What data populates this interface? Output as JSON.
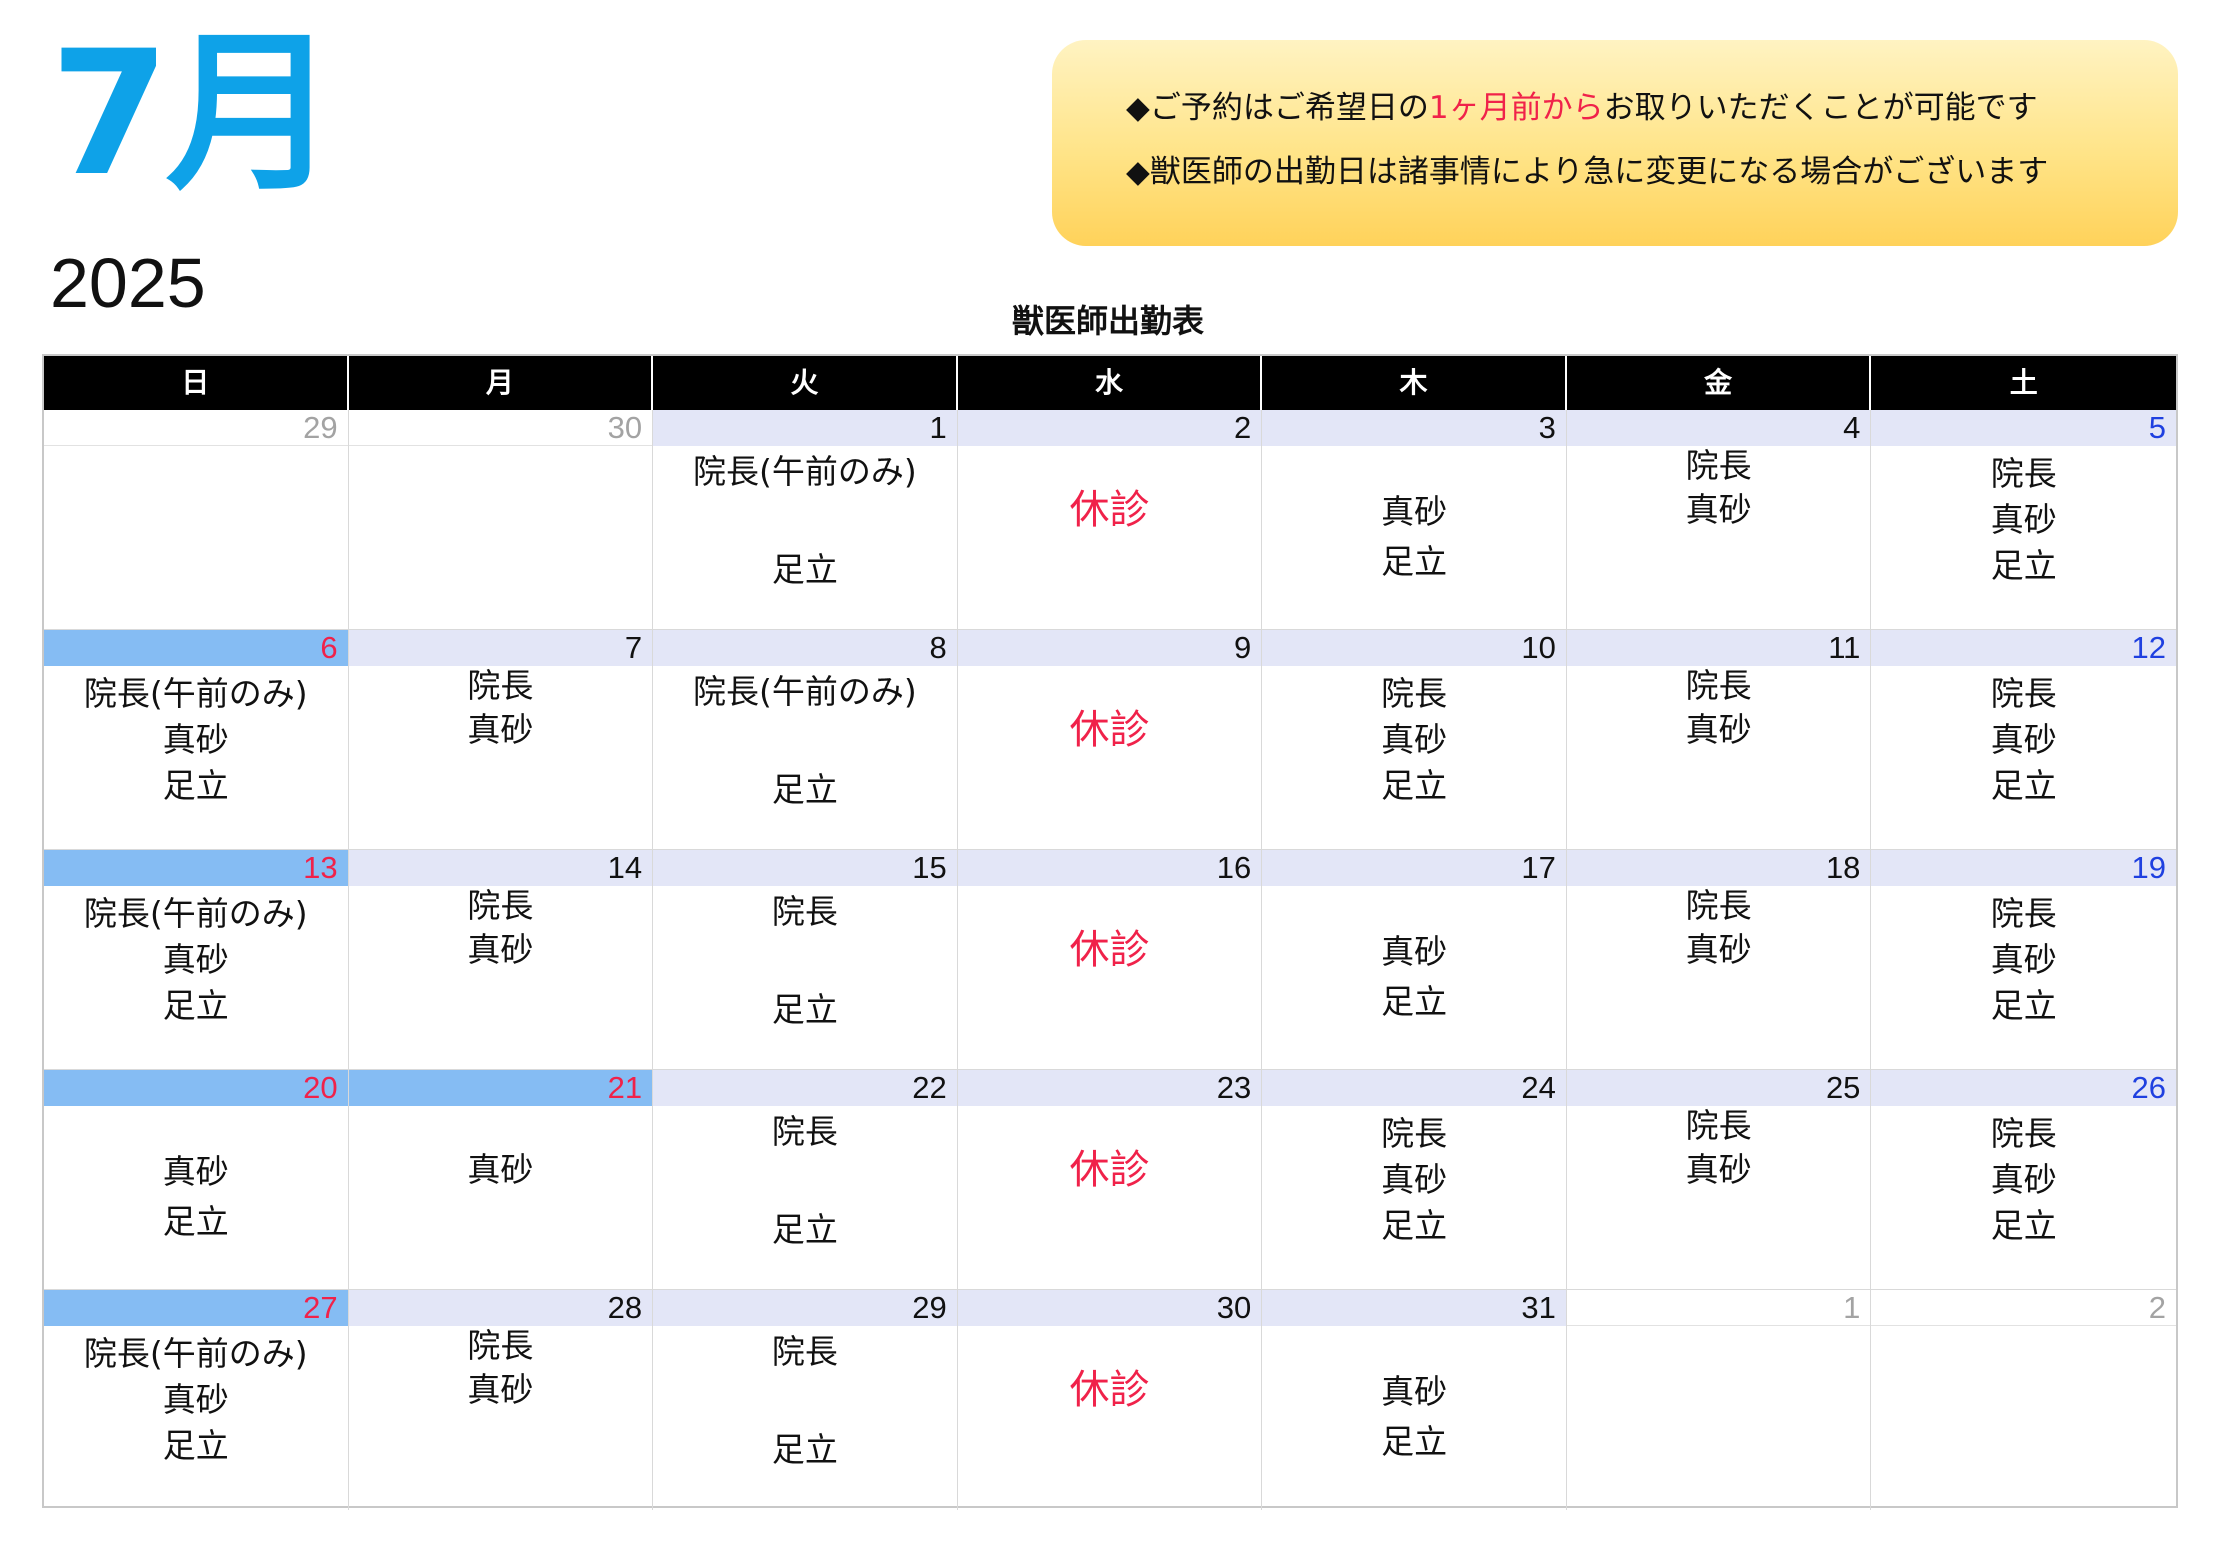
{
  "header": {
    "month": "7月",
    "year": "2025",
    "notice": [
      {
        "before": "◆ご予約はご希望日の",
        "highlight": "1ヶ月前から",
        "after": "お取りいただくことが可能です"
      },
      {
        "before": "◆獣医師の出勤日は諸事情により急に変更になる場合がございます",
        "highlight": "",
        "after": ""
      }
    ],
    "table_title": "獣医師出勤表"
  },
  "colors": {
    "month_blue": "#0ea2e8",
    "highlight_red": "#f0224a",
    "saturday_blue": "#1f40e0",
    "holiday_bg": "#85bcf3",
    "date_bg": "#e3e6f7"
  },
  "weekdays": [
    "日",
    "月",
    "火",
    "水",
    "木",
    "金",
    "土"
  ],
  "weeks": [
    [
      {
        "day": "29",
        "kind": "other",
        "lines": []
      },
      {
        "day": "30",
        "kind": "other",
        "lines": []
      },
      {
        "day": "1",
        "kind": "normal",
        "lines": [
          "院長(午前のみ)",
          "",
          "足立"
        ],
        "align": "spread"
      },
      {
        "day": "2",
        "kind": "normal",
        "lines": [
          "休診"
        ],
        "align": "closed"
      },
      {
        "day": "3",
        "kind": "normal",
        "lines": [
          "",
          "真砂",
          "足立"
        ],
        "align": "bottom2"
      },
      {
        "day": "4",
        "kind": "normal",
        "lines": [
          "院長",
          "真砂"
        ],
        "align": "top2"
      },
      {
        "day": "5",
        "kind": "sat",
        "lines": [
          "院長",
          "真砂",
          "足立"
        ],
        "align": "three"
      }
    ],
    [
      {
        "day": "6",
        "kind": "holiday",
        "lines": [
          "院長(午前のみ)",
          "真砂",
          "足立"
        ],
        "align": "three"
      },
      {
        "day": "7",
        "kind": "normal",
        "lines": [
          "院長",
          "真砂"
        ],
        "align": "top2"
      },
      {
        "day": "8",
        "kind": "normal",
        "lines": [
          "院長(午前のみ)",
          "",
          "足立"
        ],
        "align": "spread"
      },
      {
        "day": "9",
        "kind": "normal",
        "lines": [
          "休診"
        ],
        "align": "closed"
      },
      {
        "day": "10",
        "kind": "normal",
        "lines": [
          "院長",
          "真砂",
          "足立"
        ],
        "align": "three"
      },
      {
        "day": "11",
        "kind": "normal",
        "lines": [
          "院長",
          "真砂"
        ],
        "align": "top2"
      },
      {
        "day": "12",
        "kind": "sat",
        "lines": [
          "院長",
          "真砂",
          "足立"
        ],
        "align": "three"
      }
    ],
    [
      {
        "day": "13",
        "kind": "holiday",
        "lines": [
          "院長(午前のみ)",
          "真砂",
          "足立"
        ],
        "align": "three"
      },
      {
        "day": "14",
        "kind": "normal",
        "lines": [
          "院長",
          "真砂"
        ],
        "align": "top2"
      },
      {
        "day": "15",
        "kind": "normal",
        "lines": [
          "院長",
          "",
          "足立"
        ],
        "align": "spread"
      },
      {
        "day": "16",
        "kind": "normal",
        "lines": [
          "休診"
        ],
        "align": "closed"
      },
      {
        "day": "17",
        "kind": "normal",
        "lines": [
          "",
          "真砂",
          "足立"
        ],
        "align": "bottom2"
      },
      {
        "day": "18",
        "kind": "normal",
        "lines": [
          "院長",
          "真砂"
        ],
        "align": "top2"
      },
      {
        "day": "19",
        "kind": "sat",
        "lines": [
          "院長",
          "真砂",
          "足立"
        ],
        "align": "three"
      }
    ],
    [
      {
        "day": "20",
        "kind": "holiday",
        "lines": [
          "",
          "真砂",
          "足立"
        ],
        "align": "bottom2"
      },
      {
        "day": "21",
        "kind": "holiday",
        "lines": [
          "真砂"
        ],
        "align": "middle1"
      },
      {
        "day": "22",
        "kind": "normal",
        "lines": [
          "院長",
          "",
          "足立"
        ],
        "align": "spread"
      },
      {
        "day": "23",
        "kind": "normal",
        "lines": [
          "休診"
        ],
        "align": "closed"
      },
      {
        "day": "24",
        "kind": "normal",
        "lines": [
          "院長",
          "真砂",
          "足立"
        ],
        "align": "three"
      },
      {
        "day": "25",
        "kind": "normal",
        "lines": [
          "院長",
          "真砂"
        ],
        "align": "top2"
      },
      {
        "day": "26",
        "kind": "sat",
        "lines": [
          "院長",
          "真砂",
          "足立"
        ],
        "align": "three"
      }
    ],
    [
      {
        "day": "27",
        "kind": "holiday",
        "lines": [
          "院長(午前のみ)",
          "真砂",
          "足立"
        ],
        "align": "three"
      },
      {
        "day": "28",
        "kind": "normal",
        "lines": [
          "院長",
          "真砂"
        ],
        "align": "top2"
      },
      {
        "day": "29",
        "kind": "normal",
        "lines": [
          "院長",
          "",
          "足立"
        ],
        "align": "spread"
      },
      {
        "day": "30",
        "kind": "normal",
        "lines": [
          "休診"
        ],
        "align": "closed"
      },
      {
        "day": "31",
        "kind": "normal",
        "lines": [
          "",
          "真砂",
          "足立"
        ],
        "align": "bottom2"
      },
      {
        "day": "1",
        "kind": "other",
        "lines": []
      },
      {
        "day": "2",
        "kind": "other",
        "lines": []
      }
    ]
  ]
}
